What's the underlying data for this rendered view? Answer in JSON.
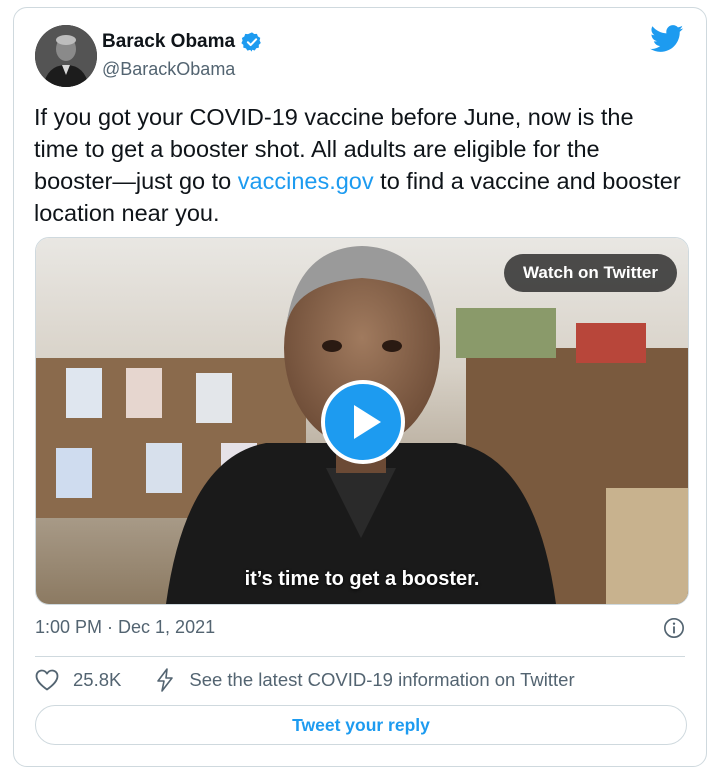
{
  "author": {
    "name": "Barack Obama",
    "handle": "@BarackObama",
    "verified": true
  },
  "tweet": {
    "text_part1": "If you got your COVID-19 vaccine before June, now is the time to get a booster shot. All adults are eligible for the booster—just go to ",
    "link_text": "vaccines.gov",
    "text_part2": " to find a vaccine and booster location near you."
  },
  "media": {
    "watch_label": "Watch on Twitter",
    "caption": "it’s time to get a booster."
  },
  "meta": {
    "timestamp": "1:00 PM · Dec 1, 2021"
  },
  "actions": {
    "like_count": "25.8K",
    "covid_info_label": "See the latest COVID-19 information on Twitter"
  },
  "reply": {
    "label": "Tweet your reply"
  },
  "colors": {
    "accent": "#1d9bf0",
    "text": "#0f1419",
    "muted": "#536471",
    "border": "#cfd9de"
  },
  "icons": [
    "avatar",
    "verified-badge-icon",
    "twitter-bird-icon",
    "play-icon",
    "info-icon",
    "heart-icon",
    "bolt-icon"
  ]
}
